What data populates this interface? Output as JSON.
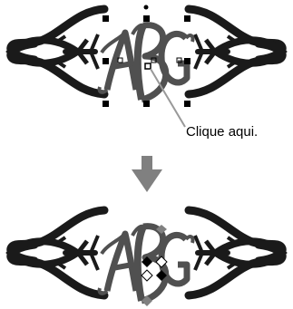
{
  "callout": {
    "text": "Clique aqui."
  },
  "monogram": {
    "letters": [
      "A",
      "B",
      "G"
    ]
  },
  "colors": {
    "ornament": "#1a1a1a",
    "letters": "#505050",
    "handle": "#000000",
    "diamond_fill": "#ffffff",
    "arrow": "#808080",
    "callout_line": "#999999"
  },
  "icons": {
    "down_arrow": "down-arrow-icon",
    "selection_handle": "square-handle-icon",
    "node_handle": "diamond-handle-icon"
  }
}
